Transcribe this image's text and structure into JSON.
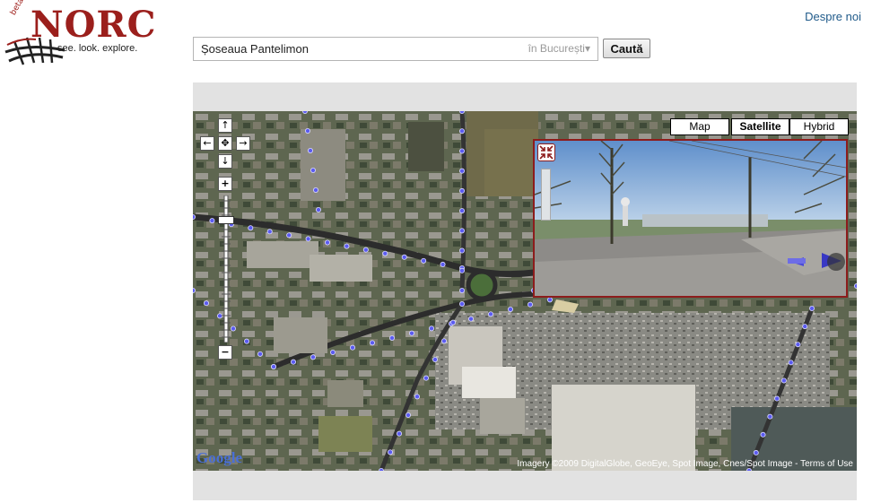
{
  "logo": {
    "beta": "beta",
    "wordmark": "NORC",
    "tagline": "see. look. explore."
  },
  "header": {
    "about_link": "Despre noi"
  },
  "search": {
    "query": "Șoseaua Pantelimon",
    "city": "în București",
    "city_arrow": "▾",
    "button": "Caută"
  },
  "map": {
    "types": [
      {
        "label": "Map",
        "active": false
      },
      {
        "label": "Satellite",
        "active": true
      },
      {
        "label": "Hybrid",
        "active": false
      }
    ],
    "google_logo": "Google",
    "attribution": "Imagery ©2009 DigitalGlobe, GeoEye, Spot Image, Cnes/Spot Image - Terms of Use"
  },
  "colors": {
    "brand": "#9b1f1c",
    "link": "#1f5a8a",
    "streetview_border": "#8d1c1c",
    "route_dots": "#5b5bf0"
  }
}
